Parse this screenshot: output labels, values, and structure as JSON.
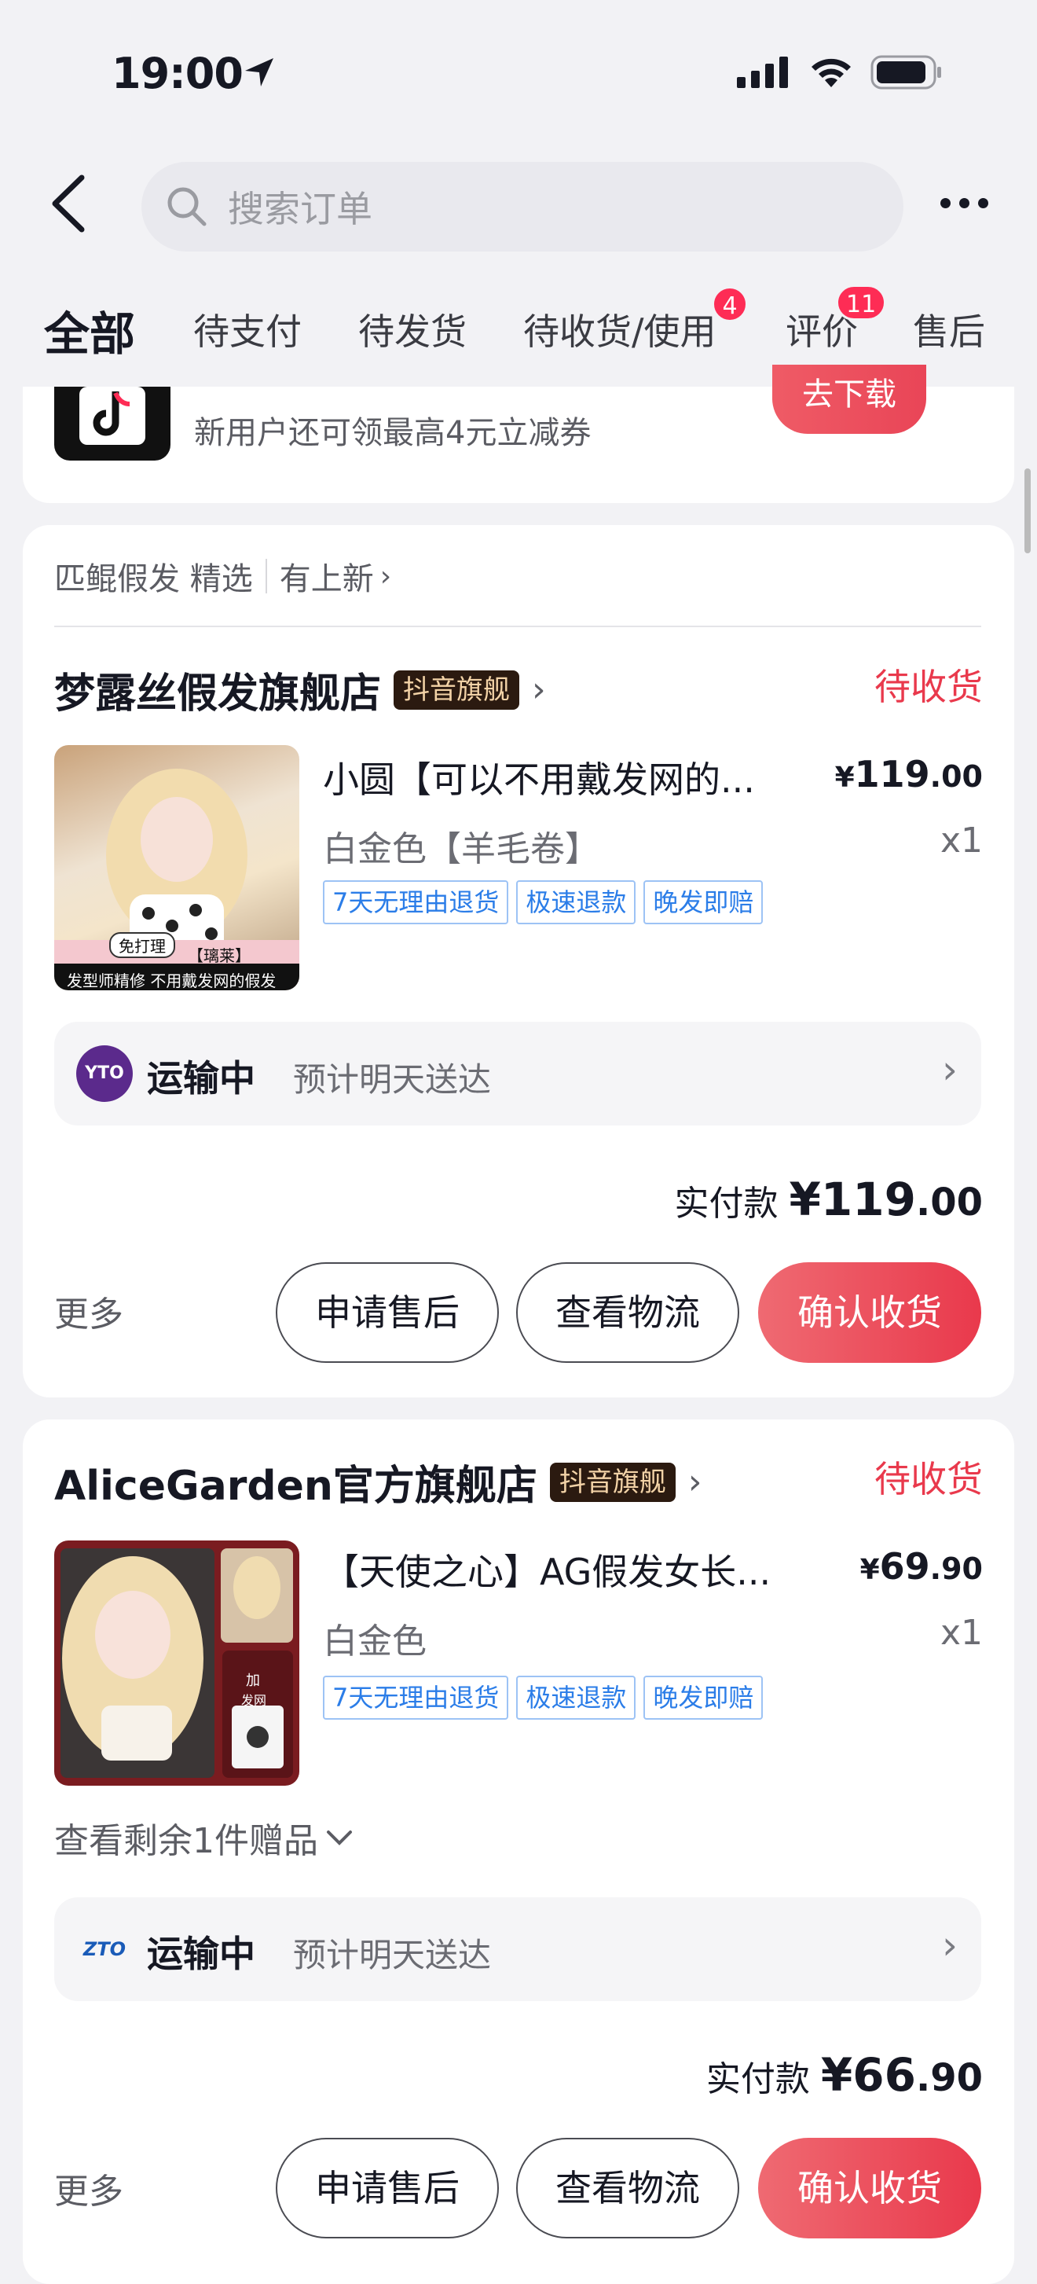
{
  "status_bar": {
    "time": "19:00"
  },
  "search": {
    "placeholder": "搜索订单"
  },
  "tabs": [
    {
      "label": "全部",
      "active": true
    },
    {
      "label": "待支付"
    },
    {
      "label": "待发货"
    },
    {
      "label": "待收货/使用",
      "badge": "4"
    },
    {
      "label": "评价",
      "badge": "11"
    },
    {
      "label": "售后"
    }
  ],
  "promo": {
    "text": "新用户还可领最高4元立减券",
    "button": "去下载"
  },
  "orders": [
    {
      "sub_header": [
        "匹鲲假发 精选",
        "有上新"
      ],
      "shop": "梦露丝假发旗舰店",
      "shop_tag": "抖音旗舰",
      "status": "待收货",
      "item": {
        "title": "小圆【可以不用戴发网的...",
        "spec": "白金色【羊毛卷】",
        "price_int": "119",
        "price_dec": ".00",
        "qty": "x1",
        "tags": [
          "7天无理由退货",
          "极速退款",
          "晚发即赔"
        ],
        "thumb_caption": [
          "免打理",
          "【璃莱】",
          "发型师精修 不用戴发网的假发"
        ]
      },
      "logistics": {
        "status": "运输中",
        "eta": "预计明天送达",
        "carrier_logo": "YTO"
      },
      "paid_label": "实付款",
      "paid_int": "119",
      "paid_dec": ".00"
    },
    {
      "shop": "AliceGarden官方旗舰店",
      "shop_tag": "抖音旗舰",
      "status": "待收货",
      "item": {
        "title": "【天使之心】AG假发女长...",
        "spec": "白金色",
        "price_int": "69",
        "price_dec": ".90",
        "qty": "x1",
        "tags": [
          "7天无理由退货",
          "极速退款",
          "晚发即赔"
        ],
        "thumb_caption": [
          "加",
          "发网"
        ]
      },
      "gift": "查看剩余1件赠品",
      "logistics": {
        "status": "运输中",
        "eta": "预计明天送达",
        "carrier_logo": "ZTO"
      },
      "paid_label": "实付款",
      "paid_int": "66",
      "paid_dec": ".90"
    }
  ],
  "actions": {
    "more": "更多",
    "after_sale": "申请售后",
    "track": "查看物流",
    "confirm": "确认收货"
  },
  "yen": "¥",
  "colors": {
    "accent": "#e9394c",
    "badge": "#fe2c55",
    "tag_blue": "#2b7de8"
  }
}
